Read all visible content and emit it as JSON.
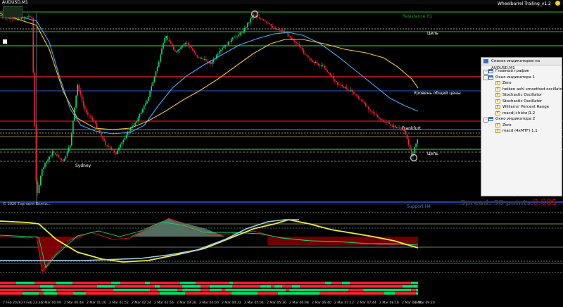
{
  "app": {
    "symbol_label": "AUDUSD,M1",
    "expert_label": "Wheelbarrel Trailing_v1.2",
    "copyright": "© 2020 Торговля Волна..."
  },
  "levels": {
    "resistance_h1": "Resistance H1",
    "target_top": "Цель",
    "common_price": "Уровень общей цены",
    "frankfurt": "Frankfurt",
    "target_bottom": "Цель",
    "sydney": "Sydney",
    "support_h4": "Support H4"
  },
  "status": {
    "spread_text": "Spread: 58 points.",
    "pnl_text": "0.00$"
  },
  "time_axis": [
    "7 Feb 2026",
    "27 Feb 23:34",
    "2 Mar 00:09",
    "2 Mar 00:48",
    "2 Mar 01:20",
    "2 Mar 01:52",
    "2 Mar 02:24",
    "2 Mar 02:56",
    "2 Mar 03:28",
    "2 Mar 04:00",
    "2 Mar 04:32",
    "2 Mar 05:04",
    "2 Mar 05:36",
    "2 Mar 06:08",
    "2 Mar 06:40",
    "2 Mar 07:12",
    "2 Mar 07:44",
    "2 Mar 08:16",
    "2 Mar 08:48",
    "2 Mar 09:20"
  ],
  "indicator_window": {
    "title": "Список индикаторов на AUDUSD,M1",
    "tree": [
      {
        "level": 0,
        "icon": "win",
        "label": "Главный график",
        "expander": "-"
      },
      {
        "level": 0,
        "icon": "win",
        "label": "Окно индикатора 1",
        "expander": "-"
      },
      {
        "level": 1,
        "icon": "ind",
        "label": "Zero"
      },
      {
        "level": 1,
        "icon": "ind",
        "label": "heiken ashi smoothed oscillator"
      },
      {
        "level": 1,
        "icon": "ind",
        "label": "Stochastic Oscillator"
      },
      {
        "level": 1,
        "icon": "ind",
        "label": "Stochastic Oscillator"
      },
      {
        "level": 1,
        "icon": "ind",
        "label": "Williams' Percent Range"
      },
      {
        "level": 1,
        "icon": "ind",
        "label": "macd(+histo)1.2"
      },
      {
        "level": 0,
        "icon": "win",
        "label": "Окно индикатора 2",
        "expander": "-"
      },
      {
        "level": 1,
        "icon": "ind",
        "label": "Zero"
      },
      {
        "level": 1,
        "icon": "ind",
        "label": "macd (4xMTF) 1.1"
      }
    ]
  },
  "colors": {
    "bull": "#00e070",
    "bear": "#ff2030",
    "ma_fast": "#4aa8ff",
    "ma_slow": "#f2c530",
    "level_green": "#22c022",
    "level_red": "#d01818",
    "level_blue": "#2a5bd8",
    "histo_red": "#8a0000",
    "pnl_red": "#c00000",
    "spread_gray": "#3a3a3a"
  }
}
